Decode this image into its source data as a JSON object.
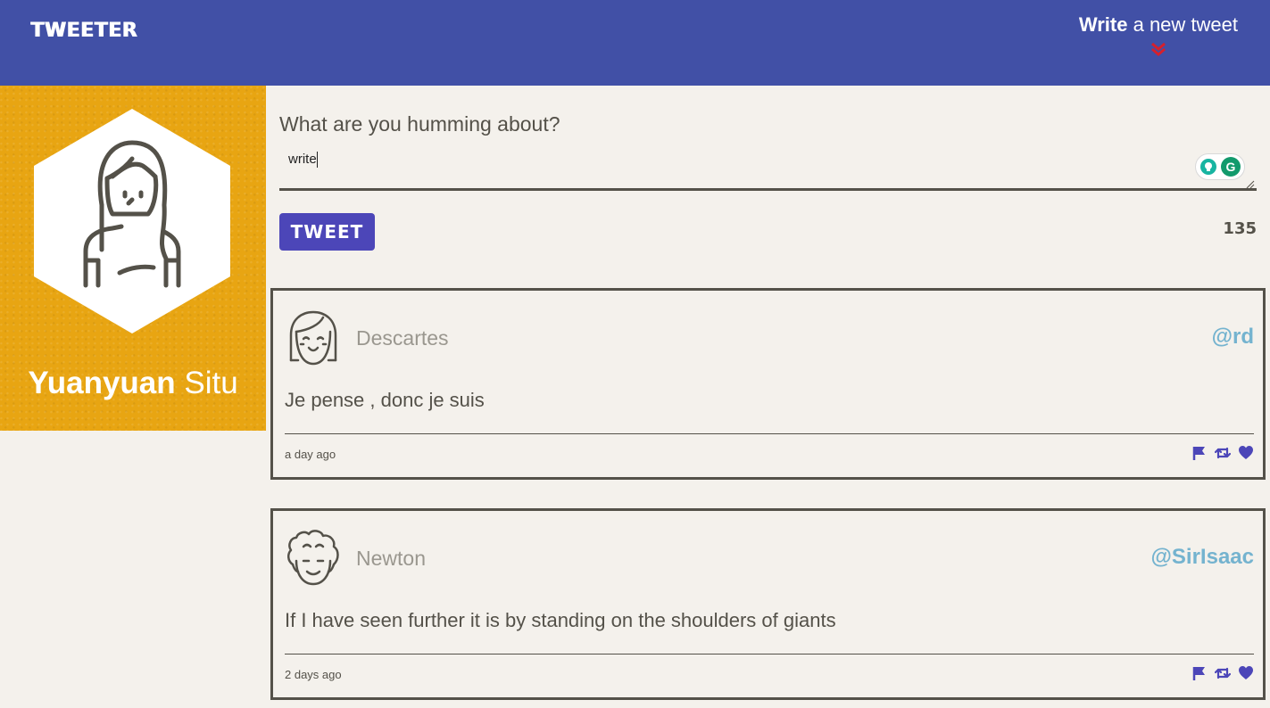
{
  "nav": {
    "brand": "TWEETER",
    "compose_toggle_bold": "Write",
    "compose_toggle_rest": " a new tweet"
  },
  "profile": {
    "first_name": "Yuanyuan",
    "last_name": "Situ"
  },
  "compose": {
    "label": "What are you humming about?",
    "input_value": "write",
    "tweet_button": "TWEET",
    "char_counter": "135"
  },
  "tweets": [
    {
      "name": "Descartes",
      "handle": "@rd",
      "body": "Je pense , donc je suis",
      "time": "a day ago",
      "avatar_icon": "smiling-girl-face-icon"
    },
    {
      "name": "Newton",
      "handle": "@SirIsaac",
      "body": "If I have seen further it is by standing on the shoulders of giants",
      "time": "2 days ago",
      "avatar_icon": "curly-hair-face-icon"
    }
  ],
  "colors": {
    "nav_bg": "#4150a6",
    "profile_bg": "#e8a512",
    "page_bg": "#f4f1ec",
    "accent_button": "#4c46b8",
    "handle": "#74b3cf",
    "chevron": "#d6202c",
    "action_icons": "#4c46b8"
  }
}
